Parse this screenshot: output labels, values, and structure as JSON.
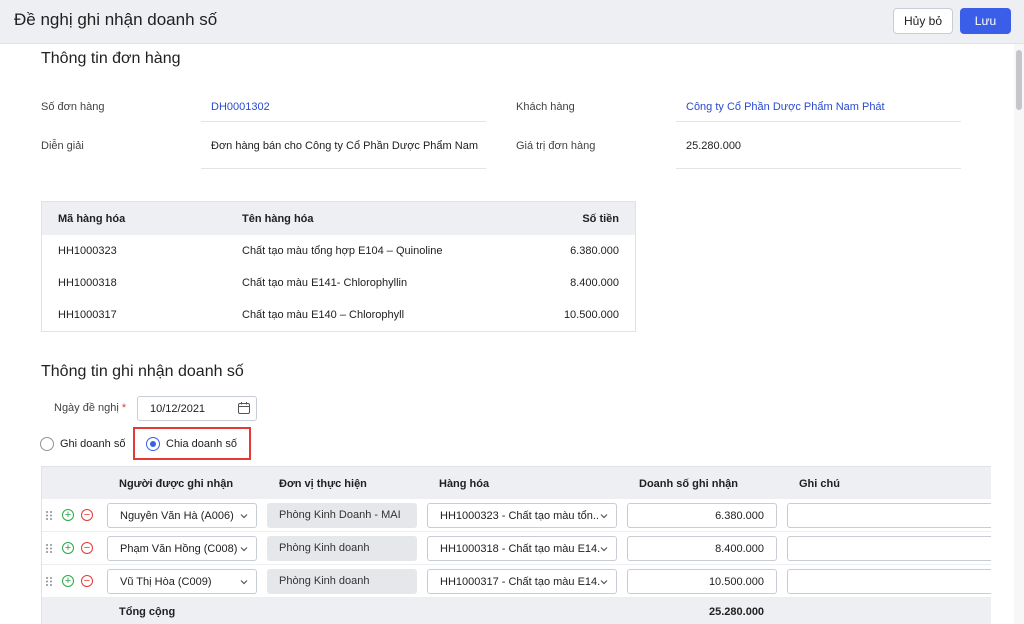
{
  "header": {
    "title": "Đề nghị ghi nhận doanh số",
    "cancel_label": "Hủy bỏ",
    "save_label": "Lưu"
  },
  "order_info": {
    "section_title": "Thông tin đơn hàng",
    "order_no_label": "Số đơn hàng",
    "order_no_value": "DH0001302",
    "customer_label": "Khách hàng",
    "customer_value": "Công ty Cổ Phần Dược Phẩm Nam Phát",
    "desc_label": "Diễn giải",
    "desc_value": "Đơn hàng bán cho Công ty Cổ Phần Dược Phẩm Nam P...",
    "amount_label": "Giá trị đơn hàng",
    "amount_value": "25.280.000"
  },
  "products": {
    "columns": [
      "Mã hàng hóa",
      "Tên hàng hóa",
      "Số tiền"
    ],
    "rows": [
      {
        "code": "HH1000323",
        "name": "Chất tạo màu tổng hợp E104 – Quinoline",
        "amount": "6.380.000"
      },
      {
        "code": "HH1000318",
        "name": "Chất tạo màu E141- Chlorophyllin",
        "amount": "8.400.000"
      },
      {
        "code": "HH1000317",
        "name": "Chất tạo màu E140 – Chlorophyll",
        "amount": "10.500.000"
      }
    ]
  },
  "revenue": {
    "section_title": "Thông tin ghi nhận doanh số",
    "date_label": "Ngày đề nghị",
    "required_mark": "*",
    "date_value": "10/12/2021",
    "option_record": "Ghi doanh số",
    "option_split": "Chia doanh số",
    "selected": "split",
    "columns": [
      "Người được ghi nhận",
      "Đơn vị thực hiện",
      "Hàng hóa",
      "Doanh số ghi nhận",
      "Ghi chú"
    ],
    "rows": [
      {
        "person": "Nguyễn Văn Hà (A006)",
        "unit": "Phòng Kinh Doanh - MAI",
        "product": "HH1000323 - Chất tạo màu tổn...",
        "amount": "6.380.000",
        "note": ""
      },
      {
        "person": "Phạm Văn Hồng (C008)",
        "unit": "Phòng Kinh doanh",
        "product": "HH1000318 - Chất tạo màu E14...",
        "amount": "8.400.000",
        "note": ""
      },
      {
        "person": "Vũ Thị Hòa (C009)",
        "unit": "Phòng Kinh doanh",
        "product": "HH1000317 - Chất tạo màu E14...",
        "amount": "10.500.000",
        "note": ""
      }
    ],
    "total_label": "Tổng cộng",
    "total_value": "25.280.000"
  },
  "colors": {
    "primary": "#3b5ee8",
    "link": "#2a4bd0",
    "danger": "#e53935",
    "success": "#27a944",
    "header_bg": "#eeeff2"
  },
  "icons": [
    "calendar-icon",
    "chevron-down-icon",
    "drag-handle-icon",
    "add-row-icon",
    "remove-row-icon"
  ]
}
